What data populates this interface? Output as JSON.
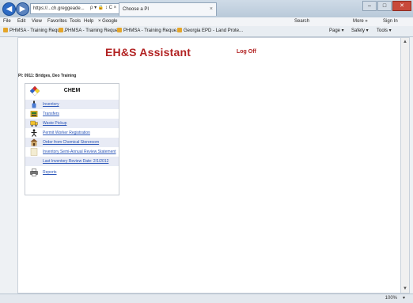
{
  "browser": {
    "address": "https://...ch.greggeade...",
    "address_controls": "ρ ▾ 🔒 ↕ C ×",
    "tab_label": "Choose a PI",
    "menu": [
      "File",
      "Edit",
      "View",
      "Favorites",
      "Tools",
      "Help"
    ],
    "google_label": "Google",
    "search_label": "Search",
    "more_label": "More »",
    "signin_label": "Sign In",
    "favorites": [
      "PHMSA - Training Reque...",
      "PHMSA - Training Reque...",
      "PHMSA - Training Reque...",
      "Georgia EPD - Land Prote..."
    ],
    "commands": [
      "Page ▾",
      "Safety ▾",
      "Tools ▾"
    ],
    "zoom": "100%"
  },
  "page": {
    "app_title": "EH&S Assistant",
    "logoff_label": "Log Off",
    "user_line": "PI: 0911: Bridges, Deo Training",
    "panel": {
      "title": "CHEM",
      "items": [
        {
          "label": "Inventory",
          "icon": "bottle-icon"
        },
        {
          "label": "Transfers",
          "icon": "transfer-icon"
        },
        {
          "label": "Waste Pickup",
          "icon": "truck-icon"
        },
        {
          "label": "Permit Worker Registration",
          "icon": "person-icon"
        },
        {
          "label": "Order from Chemical Storeroom",
          "icon": "store-icon"
        },
        {
          "label": "Inventory Semi-Annual Review Statement",
          "icon": "document-icon"
        },
        {
          "label": "Last Inventory Review Date: 2/1/2012",
          "icon": ""
        },
        {
          "label": "Reports",
          "icon": "printer-icon"
        }
      ]
    }
  },
  "colors": {
    "title_red": "#b22222",
    "link_blue": "#2b56b8",
    "row_alt": "#e8ebf5"
  }
}
